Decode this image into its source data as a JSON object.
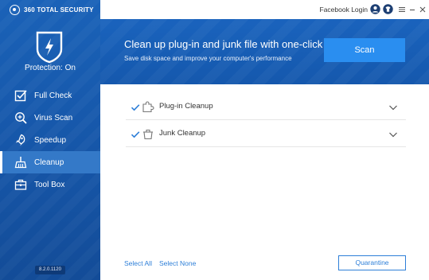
{
  "app": {
    "brand": "360 TOTAL SECURITY",
    "version": "8.2.0.1120"
  },
  "status": {
    "protection": "Protection: On"
  },
  "titlebar": {
    "facebook_login": "Facebook Login",
    "icons": [
      "user-icon",
      "shirt-icon",
      "menu-icon",
      "minimize-icon",
      "close-icon"
    ]
  },
  "nav": {
    "items": [
      {
        "label": "Full Check",
        "icon": "check-box-icon"
      },
      {
        "label": "Virus Scan",
        "icon": "virus-scan-icon"
      },
      {
        "label": "Speedup",
        "icon": "rocket-icon"
      },
      {
        "label": "Cleanup",
        "icon": "broom-icon",
        "active": true
      },
      {
        "label": "Tool Box",
        "icon": "toolbox-icon"
      }
    ]
  },
  "banner": {
    "title": "Clean up plug-in and junk file with one-click",
    "subtitle": "Save disk space and improve your computer's performance",
    "scan_label": "Scan"
  },
  "cleanup": {
    "items": [
      {
        "label": "Plug-in Cleanup",
        "checked": true,
        "icon": "puzzle-icon"
      },
      {
        "label": "Junk Cleanup",
        "checked": true,
        "icon": "trash-icon"
      }
    ]
  },
  "footer": {
    "select_all": "Select All",
    "select_none": "Select None",
    "quarantine": "Quarantine"
  },
  "colors": {
    "sidebar": "#1656a8",
    "banner": "#1558ad",
    "accent": "#2a8ef0",
    "link": "#2e7fd8"
  }
}
